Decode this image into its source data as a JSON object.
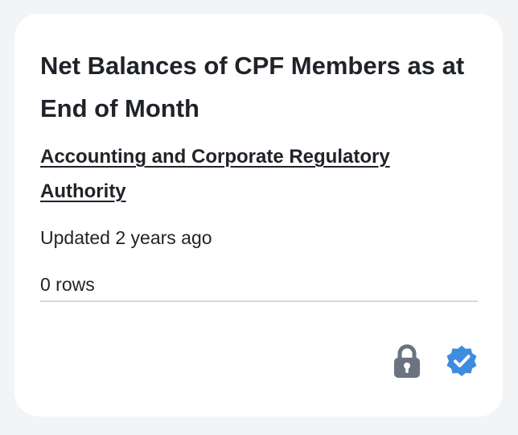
{
  "card": {
    "title": "Net Balances of CPF Members as at End of Month",
    "publisher": "Accounting and Corporate Regulatory Authority",
    "updated": "Updated 2 years ago",
    "rows": "0 rows",
    "icons": [
      "lock-icon",
      "verified-badge-icon"
    ],
    "colors": {
      "lock": "#6b7380",
      "verified": "#3d8ce0"
    }
  }
}
